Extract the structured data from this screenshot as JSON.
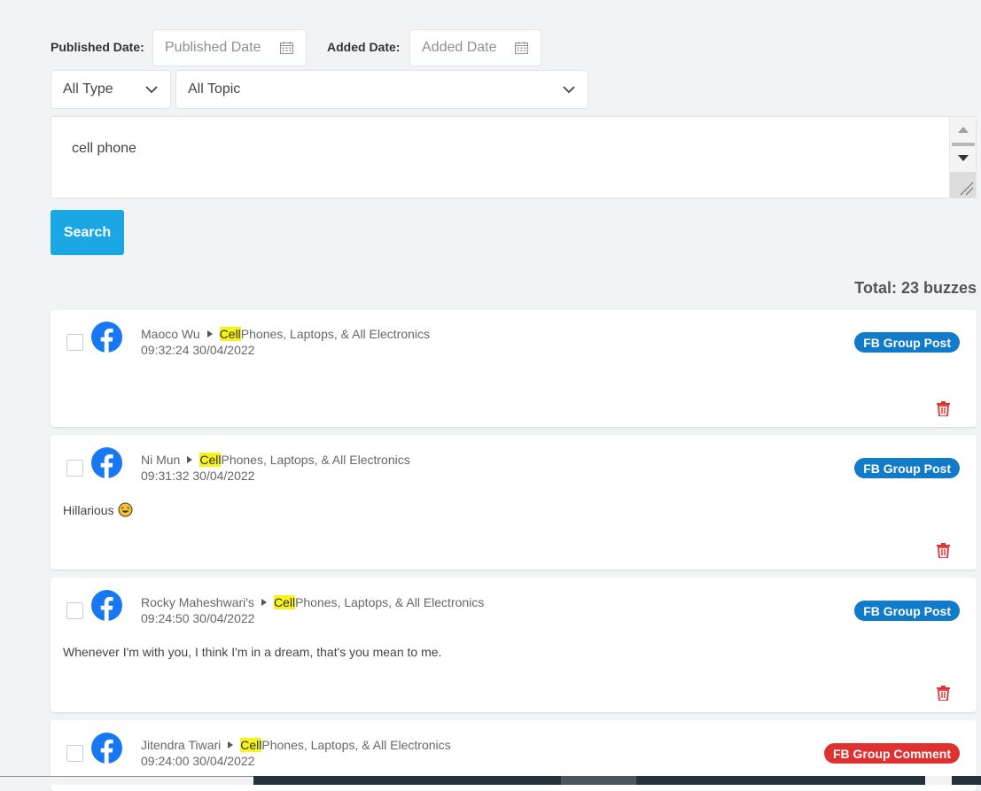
{
  "filters": {
    "published_label": "Published Date:",
    "published_placeholder": "Published Date",
    "added_label": "Added Date:",
    "added_placeholder": "Added Date",
    "type_value": "All Type",
    "topic_value": "All Topic"
  },
  "query": {
    "value": "cell phone"
  },
  "search_button": "Search",
  "total": "Total: 23 buzzes",
  "items": [
    {
      "author": "Maoco Wu",
      "group_highlight": "Cell",
      "group_rest": " Phones, Laptops, & All Electronics",
      "time": "09:32:24 30/04/2022",
      "badge": "FB Group Post",
      "content": ""
    },
    {
      "author": "Ni Mun",
      "group_highlight": "Cell",
      "group_rest": " Phones, Laptops, & All Electronics",
      "time": "09:31:32 30/04/2022",
      "badge": "FB Group Post",
      "content": "Hillarious"
    },
    {
      "author": "Rocky Maheshwari's",
      "group_highlight": "Cell",
      "group_rest": " Phones, Laptops, & All Electronics",
      "time": "09:24:50 30/04/2022",
      "badge": "FB Group Post",
      "content": "Whenever I'm with you, I think I'm in a dream, that's you mean to me."
    },
    {
      "author": "Jitendra Tiwari",
      "group_highlight": "Cell",
      "group_rest": " Phones, Laptops, & All Electronics",
      "time": "09:24:00 30/04/2022",
      "badge": "FB Group Comment",
      "content": ""
    }
  ],
  "icons": {
    "calendar": "calendar-icon",
    "chevron": "chevron-down-icon",
    "facebook": "facebook-icon",
    "trash": "trash-icon",
    "emoji": "laughing-emoji-icon"
  },
  "colors": {
    "accent": "#1aa7e3",
    "facebook": "#1877f2",
    "badge_post": "#117ac9",
    "badge_comment": "#e03131",
    "trash": "#e03131",
    "highlight": "#f6f21a"
  }
}
